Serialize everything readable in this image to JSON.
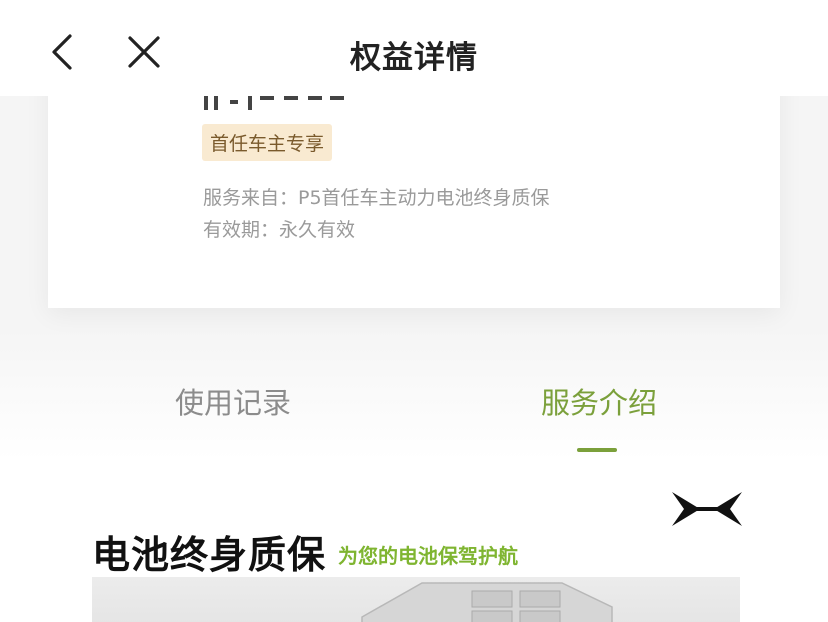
{
  "header": {
    "title": "权益详情",
    "back_icon": "chevron-left-icon",
    "close_icon": "close-icon"
  },
  "card": {
    "badge": "首任车主专享",
    "source_label": "服务来自：",
    "source_value": "P5首任车主动力电池终身质保",
    "validity_label": "有效期：",
    "validity_value": "永久有效"
  },
  "tabs": [
    {
      "label": "使用记录",
      "active": false
    },
    {
      "label": "服务介绍",
      "active": true
    }
  ],
  "banner": {
    "title": "电池终身质保",
    "subtitle": "为您的电池保驾护航",
    "logo_icon": "xpeng-logo-icon"
  },
  "colors": {
    "accent": "#7ba03b",
    "badge_bg": "#f9ead1",
    "badge_text": "#7a5a2c",
    "muted_text": "#9a9a9a",
    "subtitle_green": "#7fb531"
  }
}
